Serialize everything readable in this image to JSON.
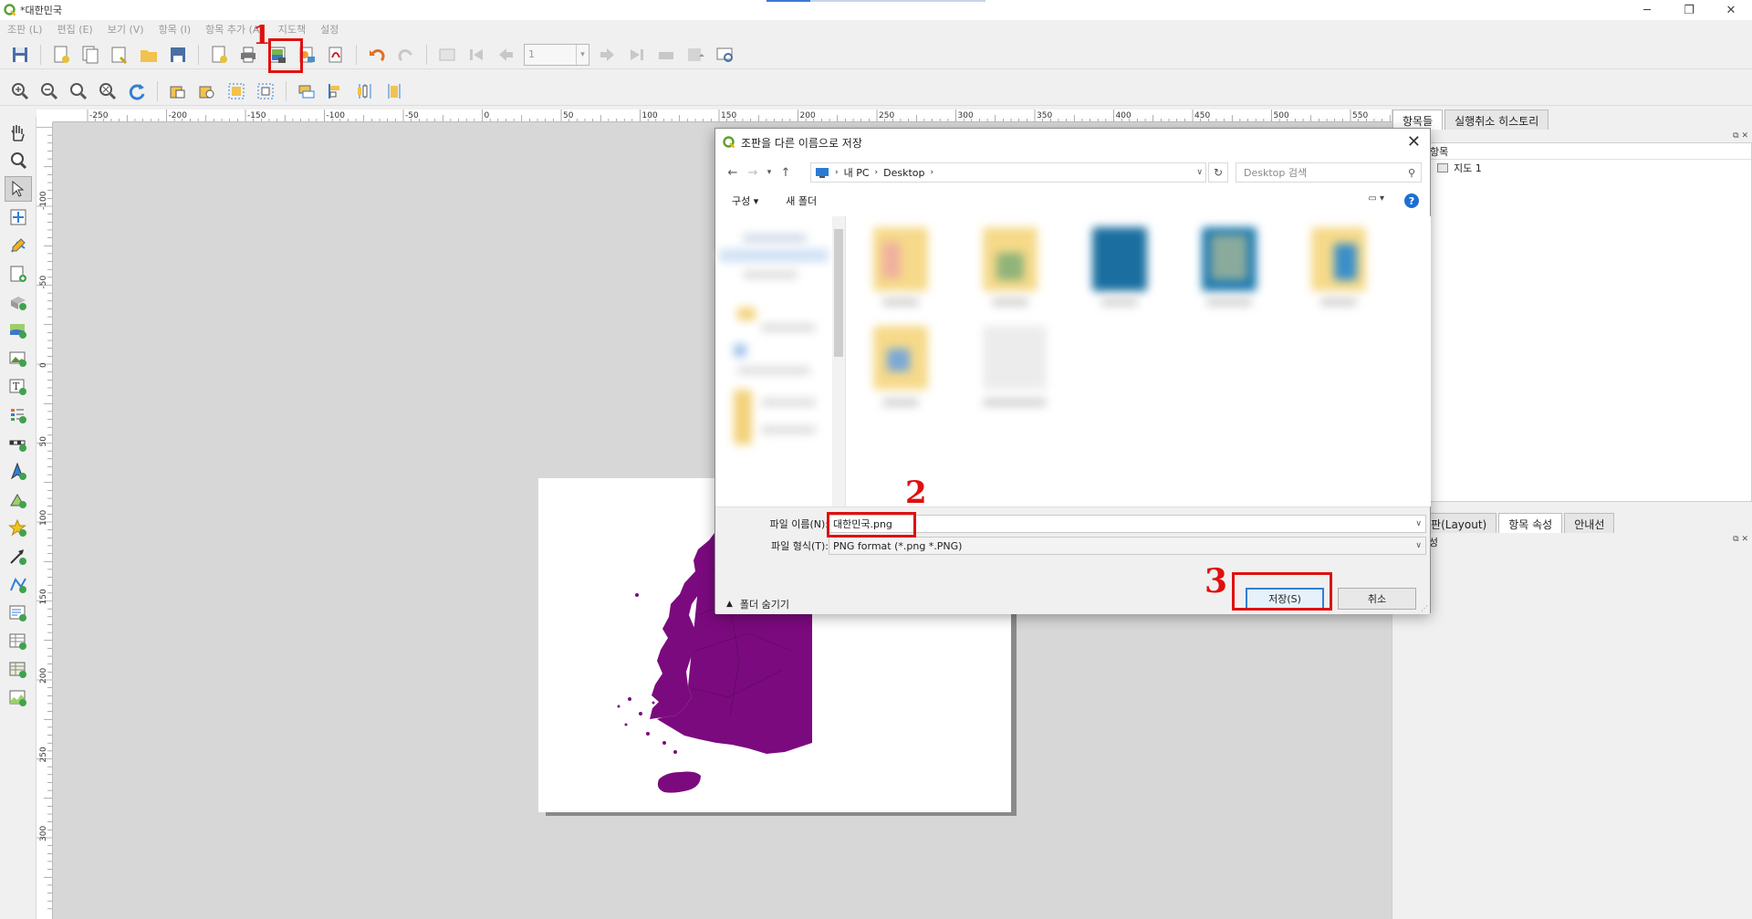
{
  "window": {
    "title": "*대한민국",
    "minimize": "─",
    "restore": "❐",
    "close": "✕"
  },
  "menubar": [
    "조판 (L)",
    "편집 (E)",
    "보기 (V)",
    "항목 (I)",
    "항목 추가 (A)",
    "지도책",
    "설정"
  ],
  "toolbar": {
    "page_value": "1"
  },
  "ruler": {
    "h_labels": [
      "-250",
      "-200",
      "-150",
      "-100",
      "-50",
      "0",
      "50",
      "100",
      "150",
      "200",
      "250",
      "300",
      "350",
      "400",
      "450",
      "500",
      "550"
    ],
    "v_labels": [
      "-100",
      "-50",
      "0",
      "50",
      "100",
      "150",
      "200",
      "250",
      "300"
    ]
  },
  "right_dock": {
    "top_tabs": [
      "항목들",
      "실행취소 히스토리"
    ],
    "items_header": "항목",
    "items": [
      {
        "name": "지도 1"
      }
    ],
    "bottom_tabs": [
      "조판(Layout)",
      "항목 속성",
      "안내선"
    ],
    "bottom_label": "항목 속성"
  },
  "dialog": {
    "title": "조판을 다른 이름으로 저장",
    "close": "✕",
    "breadcrumb": [
      "내 PC",
      "Desktop"
    ],
    "search_placeholder": "Desktop 검색",
    "organize": "구성 ▾",
    "new_folder": "새 폴더",
    "filename_label": "파일 이름(N):",
    "filename_value": "대한민국.png",
    "filetype_label": "파일 형식(T):",
    "filetype_value": "PNG format (*.png *.PNG)",
    "hide_folders": "폴더 숨기기",
    "save_button": "저장(S)",
    "cancel_button": "취소"
  },
  "annotations": {
    "step1": "1",
    "step2": "2",
    "step3": "3"
  },
  "colors": {
    "map_fill": "#7b0a7e",
    "highlight": "#e01010",
    "accent": "#2f7fd7"
  }
}
